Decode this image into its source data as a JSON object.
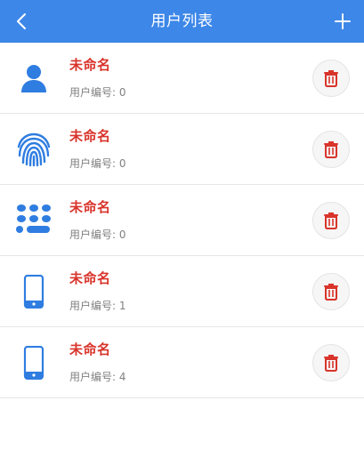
{
  "header": {
    "title": "用户列表"
  },
  "colors": {
    "header_bg": "#3d87e8",
    "icon_blue": "#2f7de1",
    "name_red": "#d9342b",
    "delete_red": "#d9342b",
    "number_gray": "#808080"
  },
  "users": [
    {
      "icon": "person-icon",
      "name": "未命名",
      "number": "用户编号: 0"
    },
    {
      "icon": "fingerprint-icon",
      "name": "未命名",
      "number": "用户编号: 0"
    },
    {
      "icon": "keypad-icon",
      "name": "未命名",
      "number": "用户编号: 0"
    },
    {
      "icon": "phone-icon",
      "name": "未命名",
      "number": "用户编号: 1"
    },
    {
      "icon": "phone-icon",
      "name": "未命名",
      "number": "用户编号: 4"
    }
  ]
}
